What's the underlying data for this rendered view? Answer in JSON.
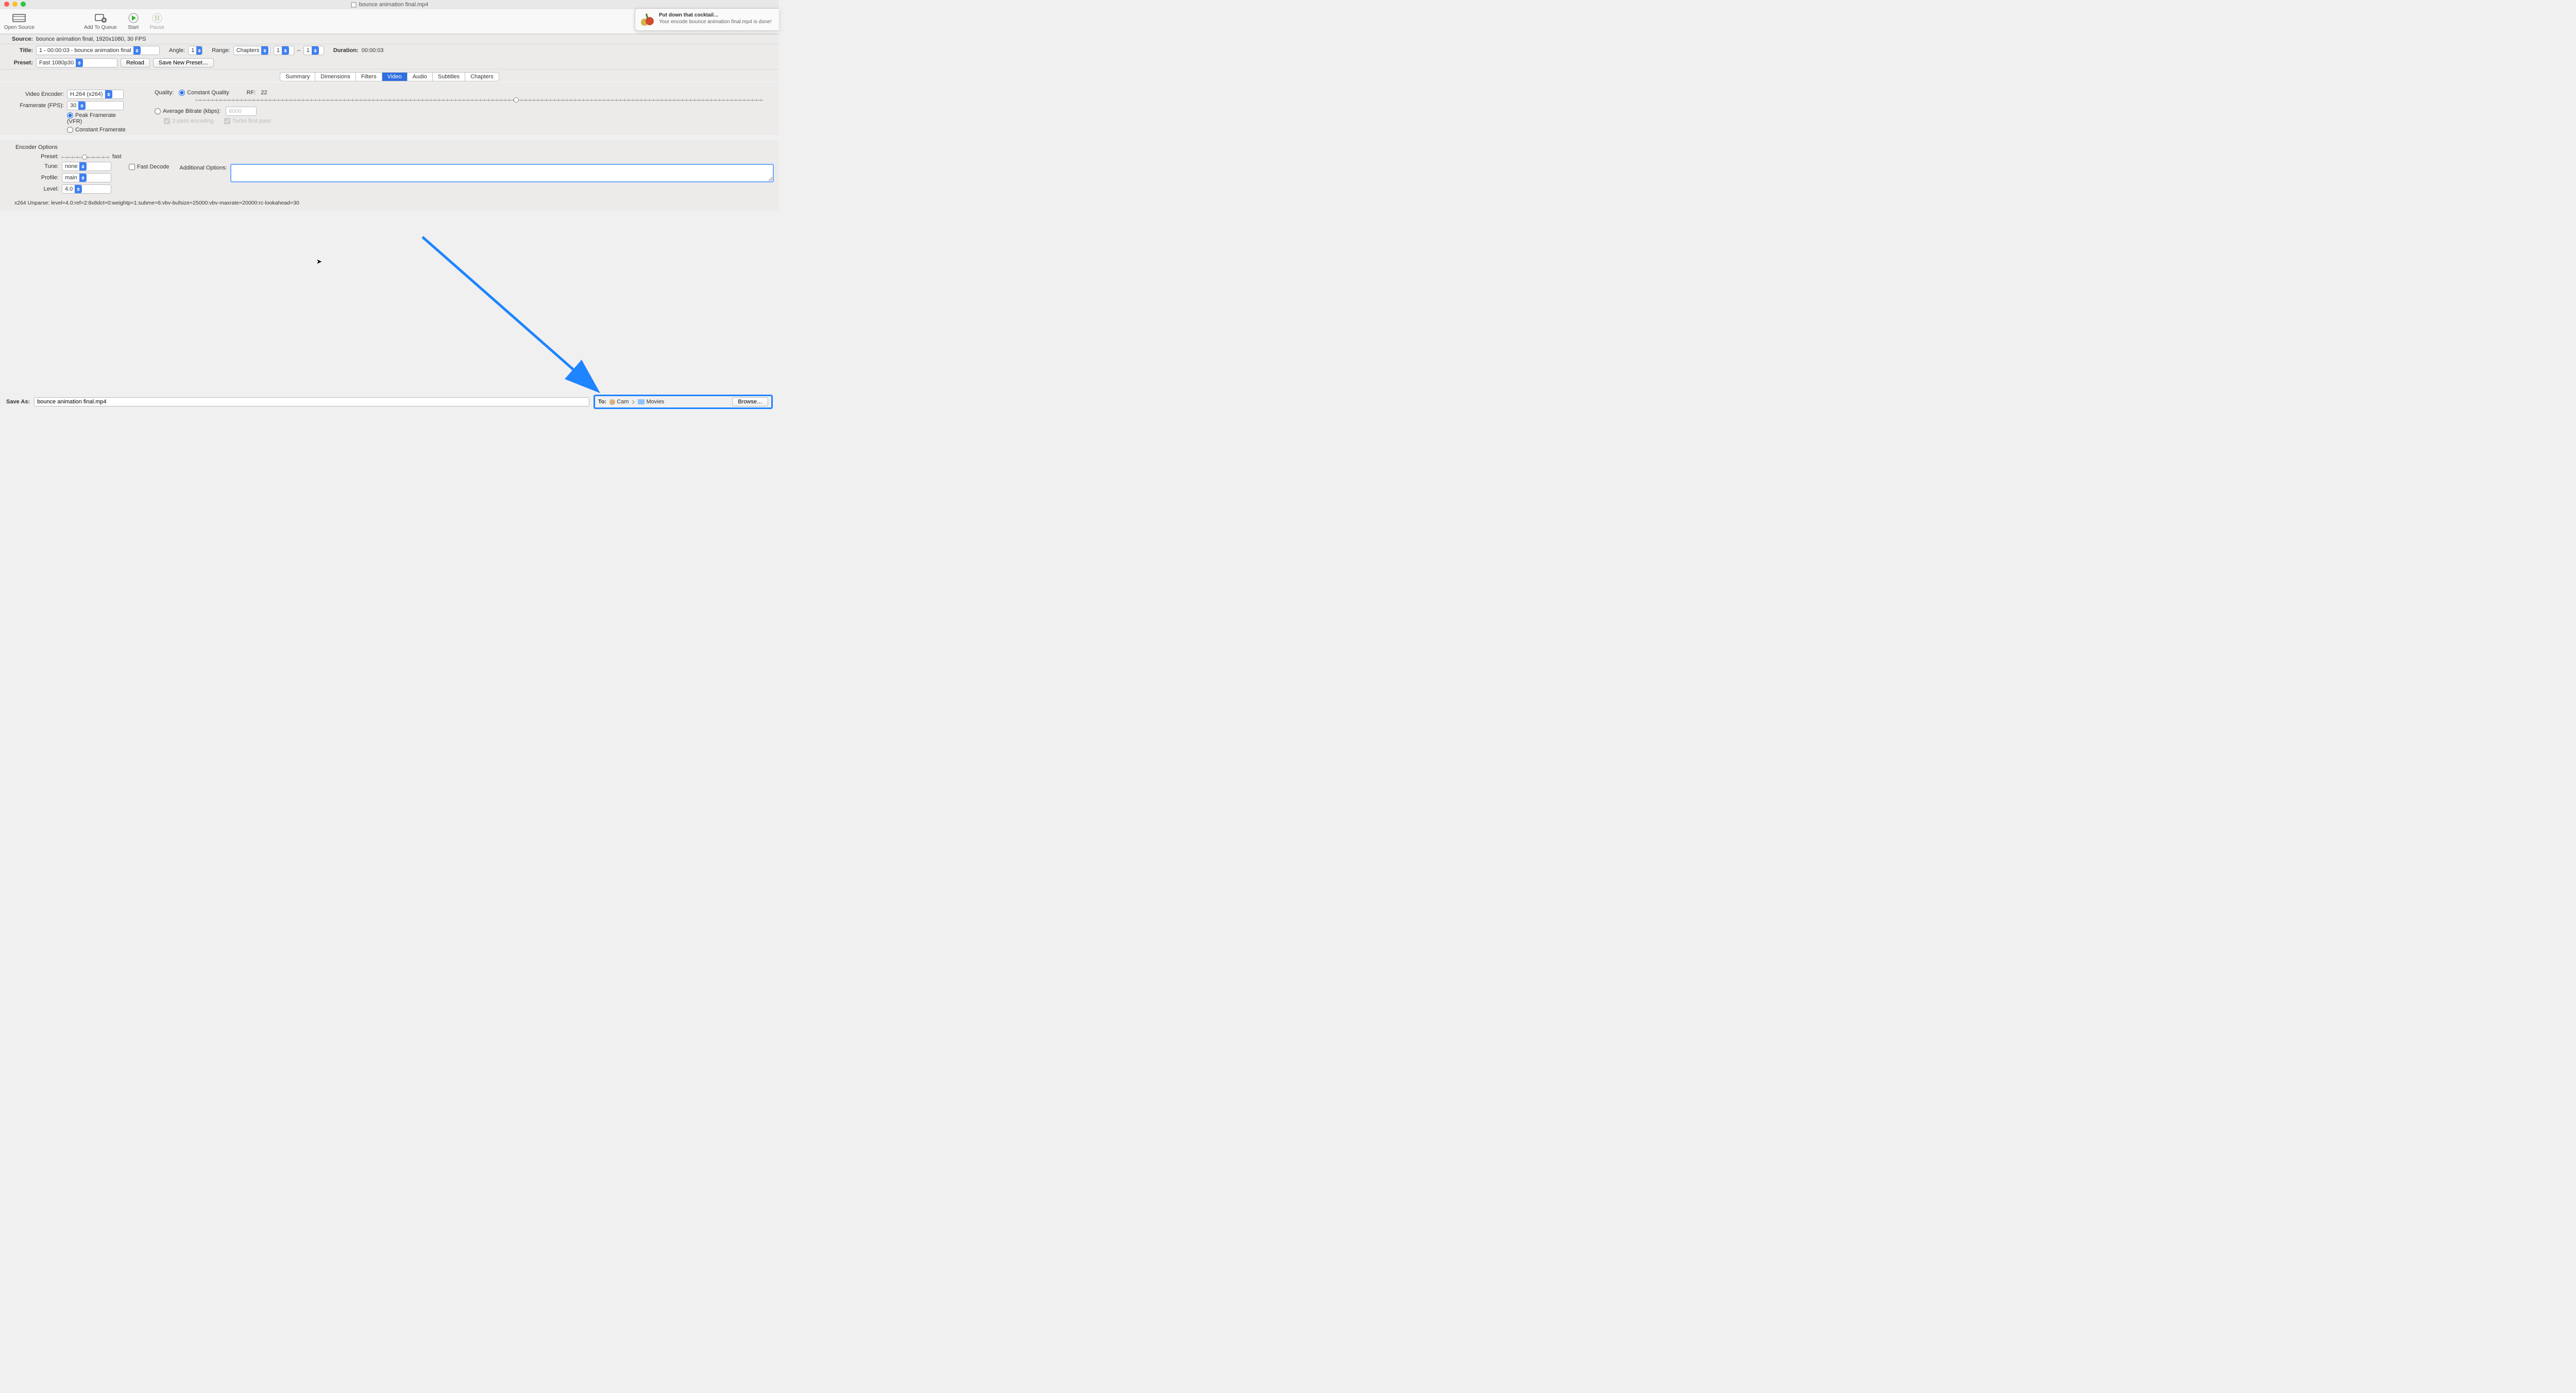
{
  "title": "bounce animation final.mp4",
  "toolbar": {
    "open_source": "Open Source",
    "add_queue": "Add To Queue",
    "start": "Start",
    "pause": "Pause"
  },
  "notification": {
    "title": "Put down that cocktail…",
    "msg": "Your encode bounce animation final.mp4 is done!"
  },
  "source": {
    "label": "Source:",
    "value": "bounce animation final, 1920x1080, 30 FPS"
  },
  "title_row": {
    "label": "Title:",
    "value": "1 - 00:00:03 - bounce animation final",
    "angle_label": "Angle:",
    "angle": "1",
    "range_label": "Range:",
    "range_mode": "Chapters",
    "range_from": "1",
    "range_sep": "–",
    "range_to": "1",
    "duration_label": "Duration:",
    "duration": "00:00:03"
  },
  "preset_row": {
    "label": "Preset:",
    "value": "Fast 1080p30",
    "reload": "Reload",
    "save_new": "Save New Preset…"
  },
  "tabs": [
    "Summary",
    "Dimensions",
    "Filters",
    "Video",
    "Audio",
    "Subtitles",
    "Chapters"
  ],
  "active_tab": 3,
  "video": {
    "encoder_label": "Video Encoder:",
    "encoder": "H.264 (x264)",
    "fps_label": "Framerate (FPS):",
    "fps": "30",
    "fr_peak": "Peak Framerate (VFR)",
    "fr_const": "Constant Framerate",
    "quality_label": "Quality:",
    "cq": "Constant Quality",
    "rf_label": "RF:",
    "rf": "22",
    "abr": "Average Bitrate (kbps):",
    "abr_val": "6000",
    "two_pass": "2-pass encoding",
    "turbo": "Turbo first pass"
  },
  "encoder": {
    "header": "Encoder Options",
    "preset_label": "Preset:",
    "preset_speed": "fast",
    "tune_label": "Tune:",
    "tune": "none",
    "fast_decode": "Fast Decode",
    "profile_label": "Profile:",
    "profile": "main",
    "level_label": "Level:",
    "level": "4.0",
    "addl_label": "Additional Options:"
  },
  "unparse": "x264 Unparse: level=4.0:ref=2:8x8dct=0:weightp=1:subme=6:vbv-bufsize=25000:vbv-maxrate=20000:rc-lookahead=30",
  "save": {
    "label": "Save As:",
    "value": "bounce animation final.mp4",
    "to_label": "To:",
    "path1": "Cam",
    "path2": "Movies",
    "browse": "Browse…"
  }
}
